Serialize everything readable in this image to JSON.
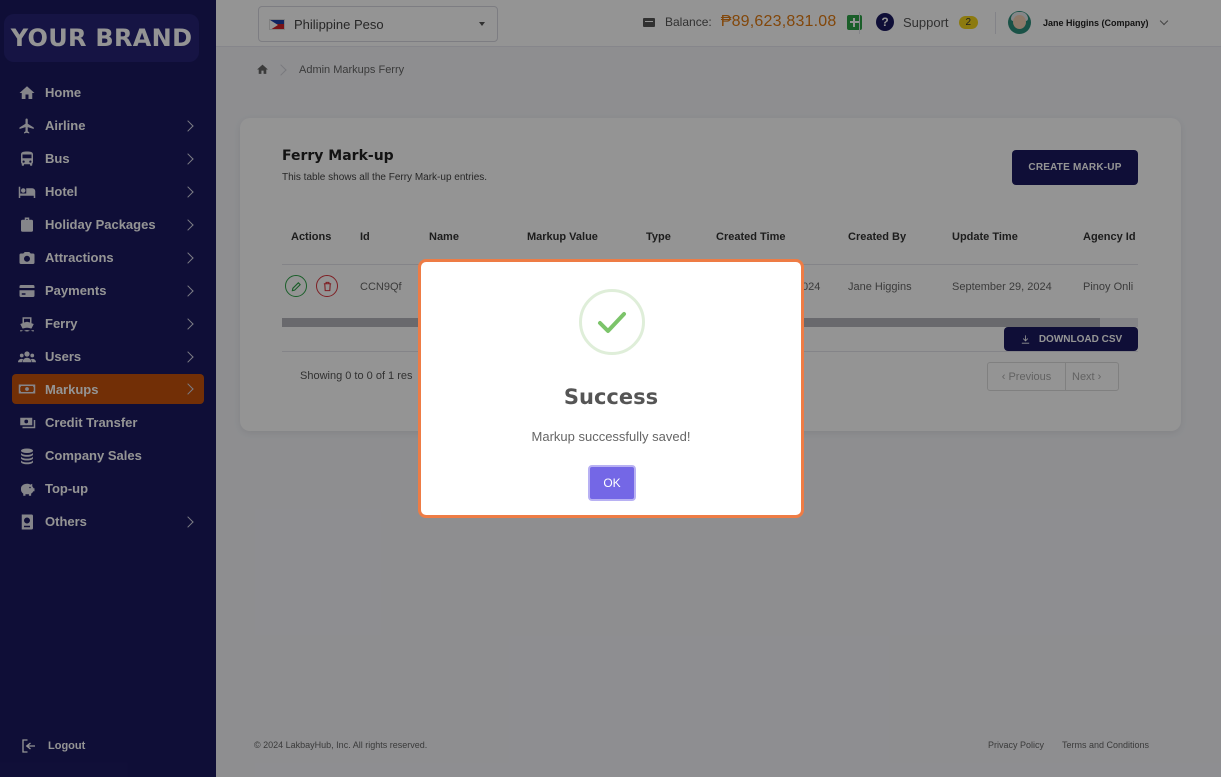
{
  "brand": "YOUR BRAND",
  "sidebar": {
    "items": [
      {
        "label": "Home"
      },
      {
        "label": "Airline"
      },
      {
        "label": "Bus"
      },
      {
        "label": "Hotel"
      },
      {
        "label": "Holiday Packages"
      },
      {
        "label": "Attractions"
      },
      {
        "label": "Payments"
      },
      {
        "label": "Ferry"
      },
      {
        "label": "Users"
      },
      {
        "label": "Markups"
      },
      {
        "label": "Credit Transfer"
      },
      {
        "label": "Company Sales"
      },
      {
        "label": "Top-up"
      },
      {
        "label": "Others"
      }
    ],
    "logout_label": "Logout"
  },
  "topbar": {
    "currency": "Philippine Peso",
    "balance_label": "Balance:",
    "balance_amount": "₱89,623,831.08",
    "support_label": "Support",
    "support_count": "2",
    "user_name": "Jane Higgins (Company)"
  },
  "breadcrumb": {
    "current": "Admin Markups Ferry"
  },
  "card": {
    "title": "Ferry Mark-up",
    "subtitle": "This table shows all the Ferry Mark-up entries.",
    "create_button": "CREATE MARK-UP",
    "columns": [
      "Actions",
      "Id",
      "Name",
      "Markup Value",
      "Type",
      "Created Time",
      "Created By",
      "Update Time",
      "Agency Id"
    ],
    "row": {
      "id": "CCN9Qf",
      "created_time_partial": "024",
      "created_by": "Jane Higgins",
      "update_time": "September 29, 2024",
      "agency_id": "Pinoy Onli"
    },
    "download_button": "DOWNLOAD CSV",
    "showing_text": "Showing 0 to 0 of 1 res",
    "pager_prev": "‹ Previous",
    "pager_next": "Next ›"
  },
  "footer": {
    "copyright": "© 2024 LakbayHub, Inc. All rights reserved.",
    "privacy": "Privacy Policy",
    "terms": "Terms and Conditions"
  },
  "modal": {
    "title": "Success",
    "message": "Markup successfully saved!",
    "ok_label": "OK"
  },
  "colors": {
    "sidebar_bg": "#1b1960",
    "active_item": "#c4520b",
    "balance_amount": "#e07a12",
    "modal_border": "#ee7c45",
    "ok_button": "#7467e6"
  }
}
